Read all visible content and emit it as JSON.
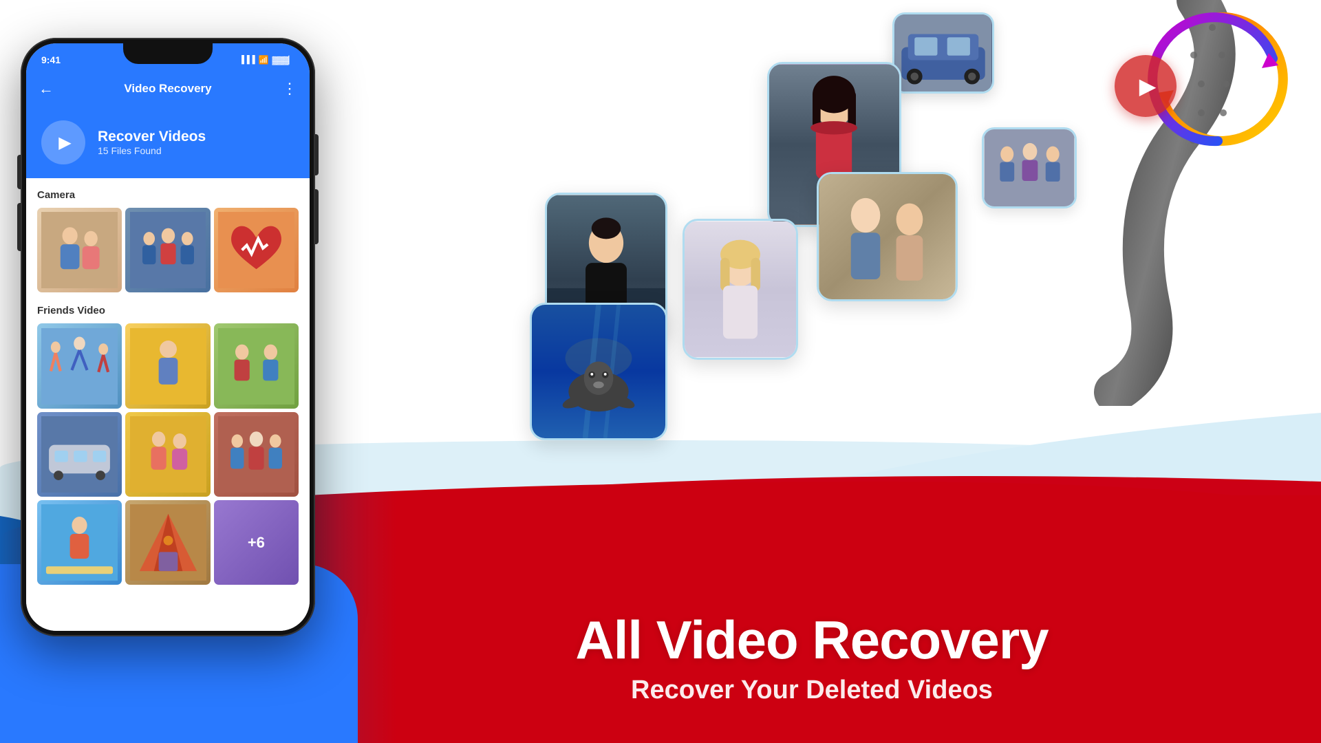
{
  "app": {
    "title": "All Video Recovery",
    "subtitle": "Recover Your Deleted Videos"
  },
  "phone": {
    "status_time": "9:41",
    "status_icons": [
      "signal",
      "wifi",
      "battery"
    ],
    "app_bar_title": "Video Recovery",
    "back_arrow": "←",
    "menu_dots": "⋮",
    "recover_card": {
      "title": "Recover Videos",
      "subtitle": "15 Files Found"
    },
    "sections": [
      {
        "title": "Camera",
        "thumbs": [
          "couple",
          "friends1",
          "heart"
        ]
      },
      {
        "title": "Friends Video",
        "thumbs": [
          "jump",
          "group1",
          "group2",
          "bus",
          "women",
          "group3",
          "beach",
          "camp",
          "plus6"
        ]
      }
    ],
    "plus_label": "+6"
  },
  "bottom_text": {
    "title": "All Video Recovery",
    "subtitle": "Recover Your Deleted Videos"
  },
  "floating_photos": [
    {
      "id": "woman1",
      "label": "Woman portrait"
    },
    {
      "id": "man",
      "label": "Man in black"
    },
    {
      "id": "woman2",
      "label": "Young woman"
    },
    {
      "id": "couple2",
      "label": "Couple photo"
    },
    {
      "id": "seal",
      "label": "Seal underwater"
    },
    {
      "id": "car",
      "label": "Car photo"
    },
    {
      "id": "city",
      "label": "City/people photo"
    }
  ]
}
